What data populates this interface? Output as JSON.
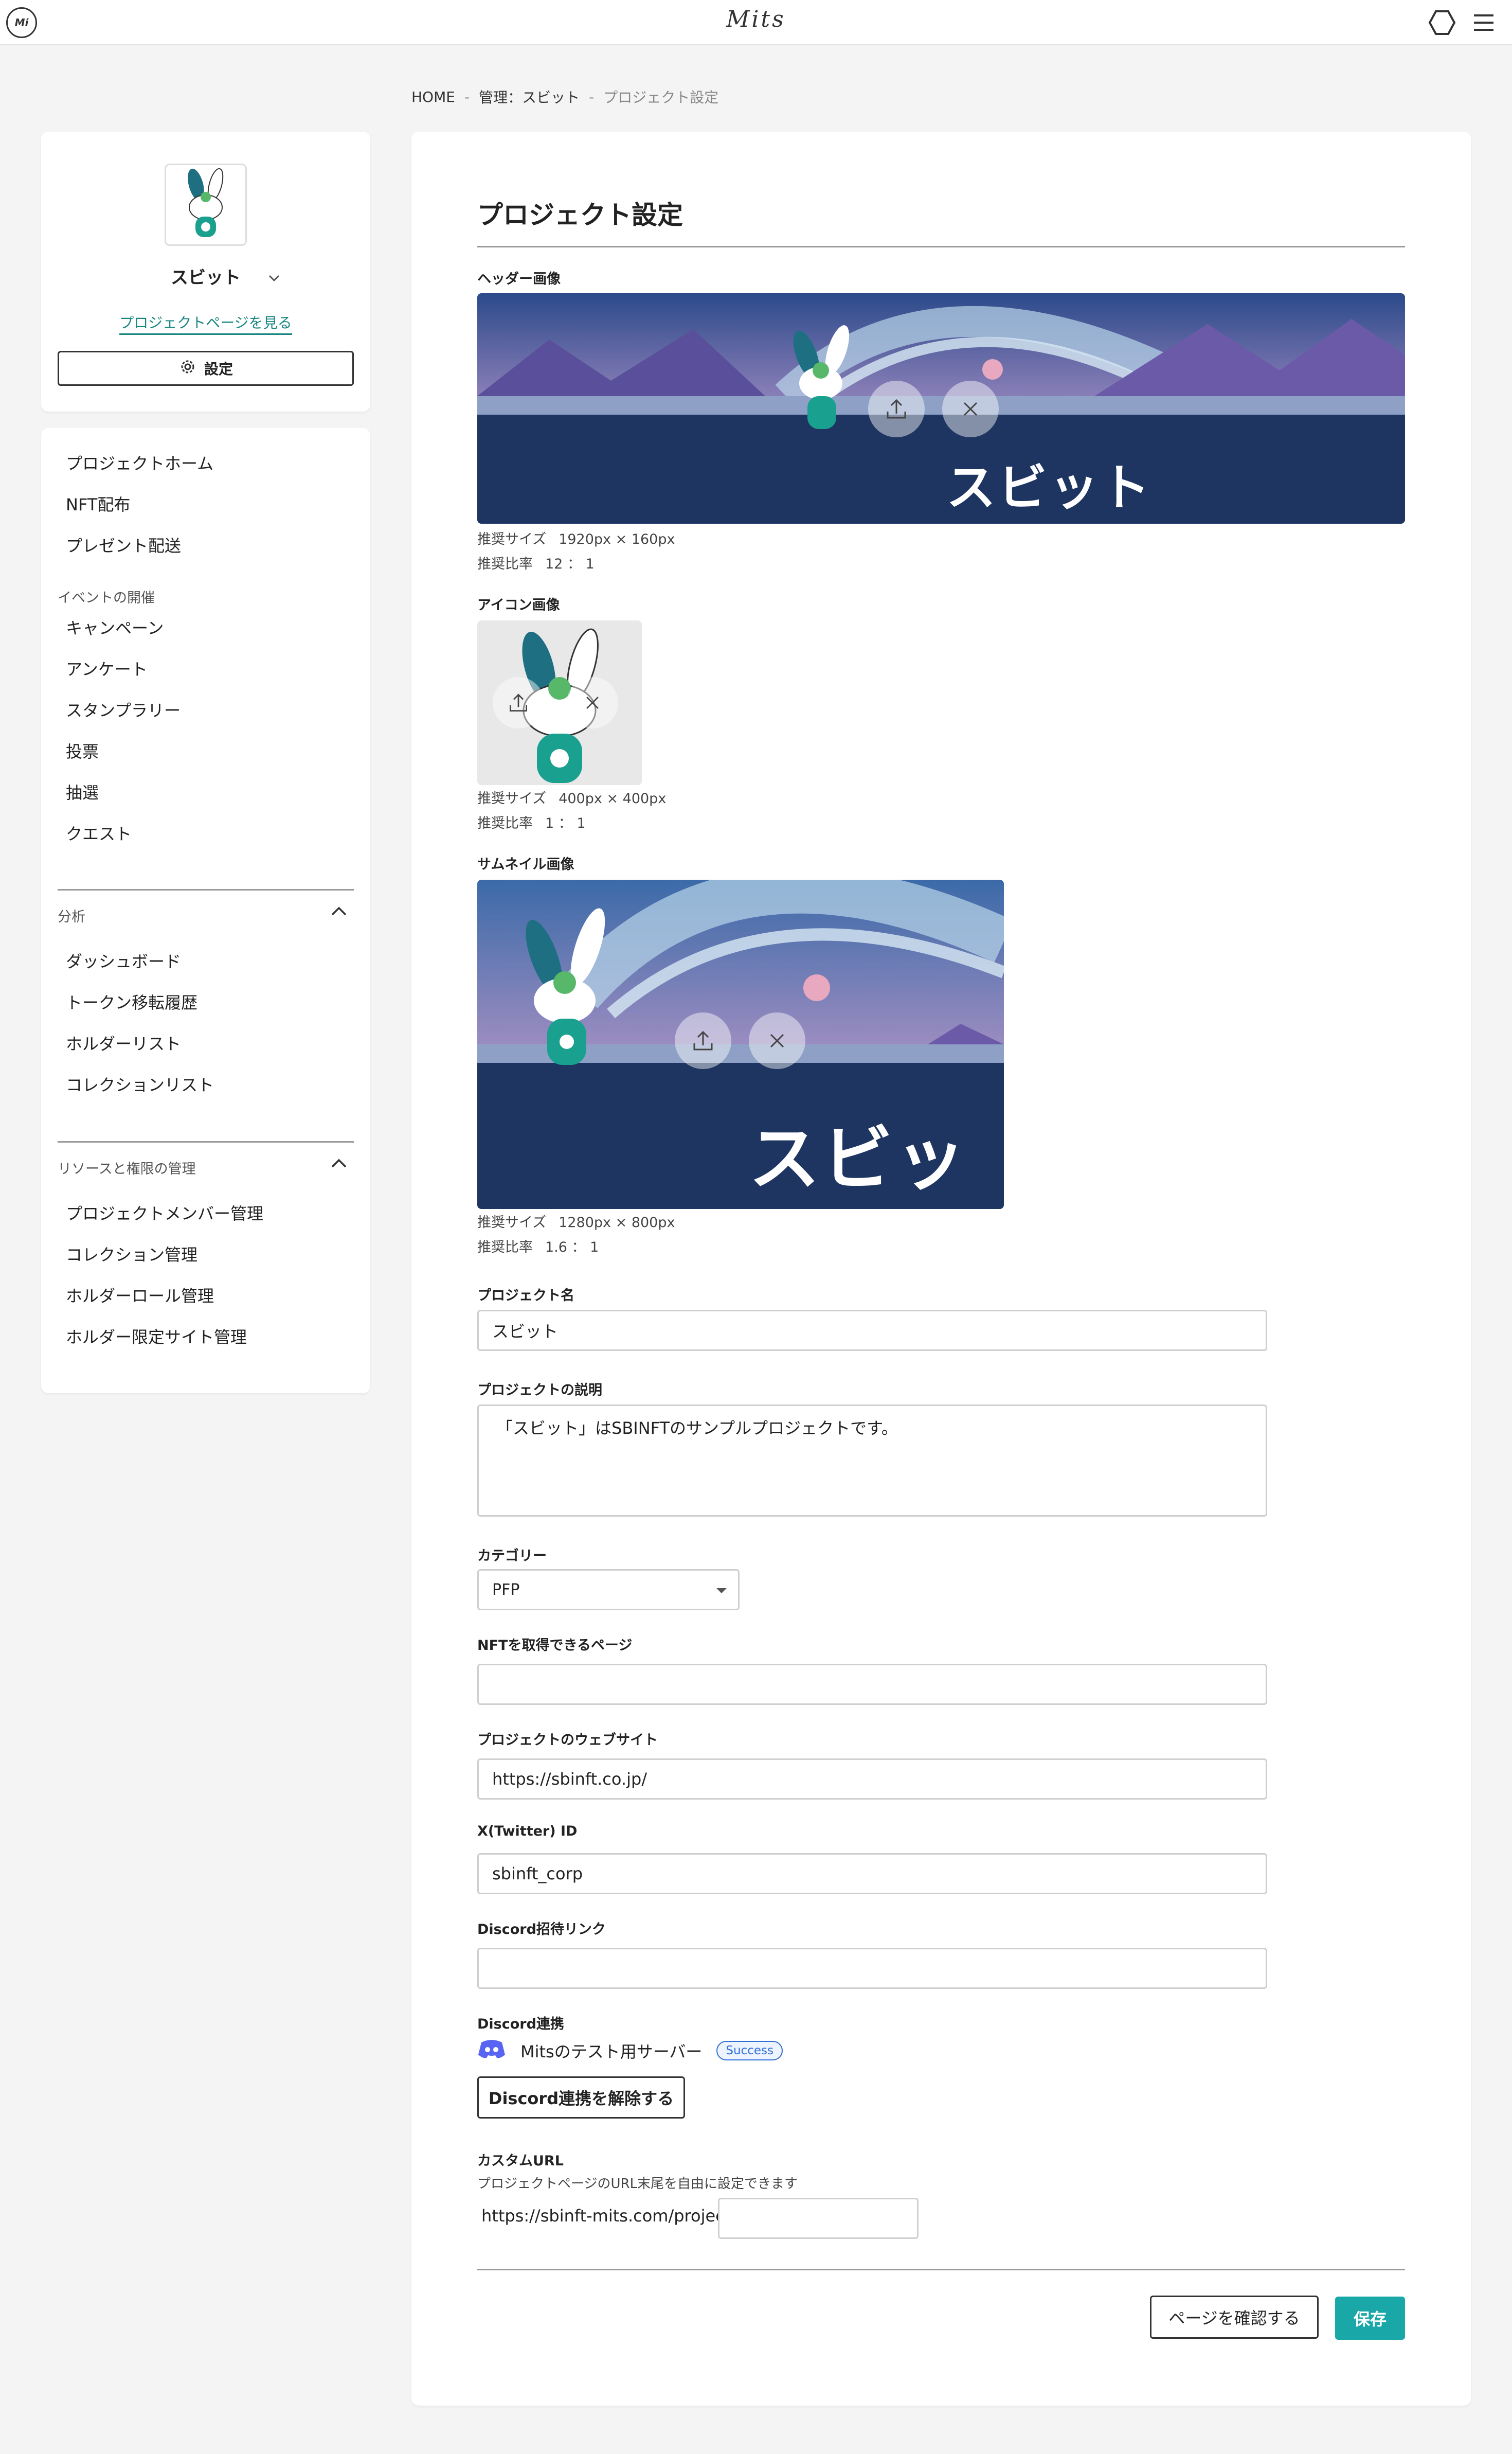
{
  "app": {
    "logo_text": "Mi",
    "brand_text": "Mits"
  },
  "breadcrumb": {
    "items": [
      "HOME",
      "管理：スビット",
      "プロジェクト設定"
    ],
    "separator": "-"
  },
  "profile": {
    "name": "スビット",
    "view_link": "プロジェクトページを見る",
    "settings_label": "設定"
  },
  "sidebar": {
    "top_items": [
      "プロジェクトホーム",
      "NFT配布",
      "プレゼント配送"
    ],
    "event_group": "イベントの開催",
    "event_items": [
      "キャンペーン",
      "アンケート",
      "スタンプラリー",
      "投票",
      "抽選",
      "クエスト"
    ],
    "analysis_group": "分析",
    "analysis_items": [
      "ダッシュボード",
      "トークン移転履歴",
      "ホルダーリスト",
      "コレクションリスト"
    ],
    "resource_group": "リソースと権限の管理",
    "resource_items": [
      "プロジェクトメンバー管理",
      "コレクション管理",
      "ホルダーロール管理",
      "ホルダー限定サイト管理"
    ]
  },
  "main": {
    "title": "プロジェクト設定",
    "header_image": {
      "label": "ヘッダー画像",
      "overlay_text": "スビット",
      "size_label": "推奨サイズ",
      "size_value": "1920px × 160px",
      "ratio_label": "推奨比率",
      "ratio_value": "12 ： 1"
    },
    "icon_image": {
      "label": "アイコン画像",
      "size_label": "推奨サイズ",
      "size_value": "400px × 400px",
      "ratio_label": "推奨比率",
      "ratio_value": "1 ： 1"
    },
    "thumbnail_image": {
      "label": "サムネイル画像",
      "overlay_text": "スビット",
      "size_label": "推奨サイズ",
      "size_value": "1280px × 800px",
      "ratio_label": "推奨比率",
      "ratio_value": "1.6 ： 1"
    },
    "project_name": {
      "label": "プロジェクト名",
      "value": "スビット"
    },
    "description": {
      "label": "プロジェクトの説明",
      "value": "「スビット」はSBINFTのサンプルプロジェクトです。"
    },
    "category": {
      "label": "カテゴリー",
      "value": "PFP"
    },
    "nft_page": {
      "label": "NFTを取得できるページ",
      "value": ""
    },
    "website": {
      "label": "プロジェクトのウェブサイト",
      "value": "https://sbinft.co.jp/"
    },
    "twitter": {
      "label": "X(Twitter) ID",
      "value": "sbinft_corp"
    },
    "discord_invite": {
      "label": "Discord招待リンク",
      "value": ""
    },
    "discord_link": {
      "label": "Discord連携",
      "server_name": "Mitsのテスト用サーバー",
      "status": "Success",
      "unlink_button": "Discord連携を解除する"
    },
    "custom_url": {
      "label": "カスタムURL",
      "hint": "プロジェクトページのURL末尾を自由に設定できます",
      "prefix": "https://sbinft-mits.com/project/",
      "value": ""
    },
    "preview_button": "ページを確認する",
    "save_button": "保存"
  },
  "colors": {
    "accent": "#19a7a8",
    "link": "#19857f",
    "badge": "#2f6fd6",
    "discord": "#5865f2",
    "image_navy": "#1e3562"
  },
  "icons": [
    "hexagon-icon",
    "hamburger-menu-icon",
    "chevron-down-icon",
    "gear-icon",
    "chevron-up-icon",
    "upload-icon",
    "close-icon",
    "discord-icon"
  ]
}
